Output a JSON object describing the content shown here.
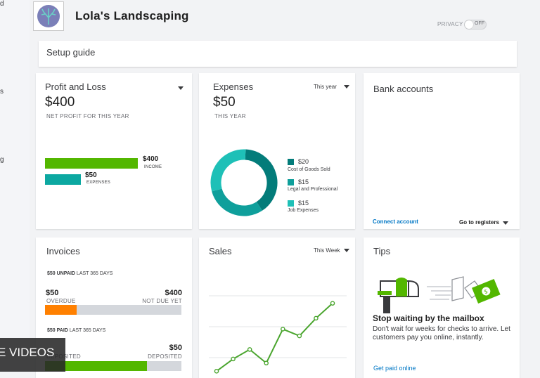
{
  "sidebar_fragments": [
    "d",
    "s",
    "g"
  ],
  "company": {
    "name": "Lola's Landscaping"
  },
  "privacy": {
    "label": "PRIVACY",
    "toggle": "OFF"
  },
  "setup_guide": {
    "label": "Setup guide"
  },
  "profit_loss": {
    "title": "Profit and Loss",
    "amount": "$400",
    "subtitle": "NET PROFIT FOR THIS YEAR",
    "income_value": "$400",
    "income_label": "INCOME",
    "expenses_value": "$50",
    "expenses_label": "EXPENSES",
    "income_fraction": 1.0,
    "expenses_fraction": 0.125
  },
  "expenses": {
    "title": "Expenses",
    "period": "This year",
    "amount": "$50",
    "subtitle": "THIS YEAR",
    "legend": [
      {
        "value": "$20",
        "label": "Cost of Goods Sold",
        "color": "#037c7a"
      },
      {
        "value": "$15",
        "label": "Legal and Professional",
        "color": "#0f9f9b"
      },
      {
        "value": "$15",
        "label": "Job Expenses",
        "color": "#1ec0b7"
      }
    ]
  },
  "bank_accounts": {
    "title": "Bank accounts",
    "connect": "Connect account",
    "registers": "Go to registers"
  },
  "invoices": {
    "title": "Invoices",
    "unpaid_amount": "$50",
    "unpaid_label": "UNPAID",
    "unpaid_period": "LAST 365 DAYS",
    "overdue_amount": "$50",
    "overdue_label": "OVERDUE",
    "not_due_amount": "$400",
    "not_due_label": "NOT DUE YET",
    "overdue_fraction": 0.23,
    "paid_amount": "$50",
    "paid_label": "PAID",
    "paid_period": "LAST 365 DAYS",
    "deposited_left_label": "DEPOSITED",
    "deposited_amount": "$50",
    "deposited_right_label": "DEPOSITED"
  },
  "sales": {
    "title": "Sales",
    "period": "This Week"
  },
  "tips": {
    "title": "Tips",
    "headline": "Stop waiting by the mailbox",
    "body": "Don't wait for weeks for checks to arrive. Let customers pay you online, instantly.",
    "link": "Get paid online"
  },
  "video_badge": {
    "label": "E VIDEOS"
  },
  "colors": {
    "green": "#53b700",
    "teal": "#0ca8a1",
    "orange": "#ff8000",
    "gray_track": "#d4d7dc",
    "link_blue": "#0077c5"
  },
  "chart_data": [
    {
      "type": "pie",
      "title": "Expenses",
      "categories": [
        "Cost of Goods Sold",
        "Legal and Professional",
        "Job Expenses"
      ],
      "values": [
        20,
        15,
        15
      ]
    },
    {
      "type": "line",
      "title": "Sales",
      "x": [
        1,
        2,
        3,
        4,
        5,
        6,
        7,
        8
      ],
      "values": [
        0,
        0.9,
        1.6,
        0.6,
        3.1,
        2.6,
        3.9,
        5.0
      ],
      "ylim": [
        -0.5,
        5.5
      ],
      "grid": true
    }
  ]
}
